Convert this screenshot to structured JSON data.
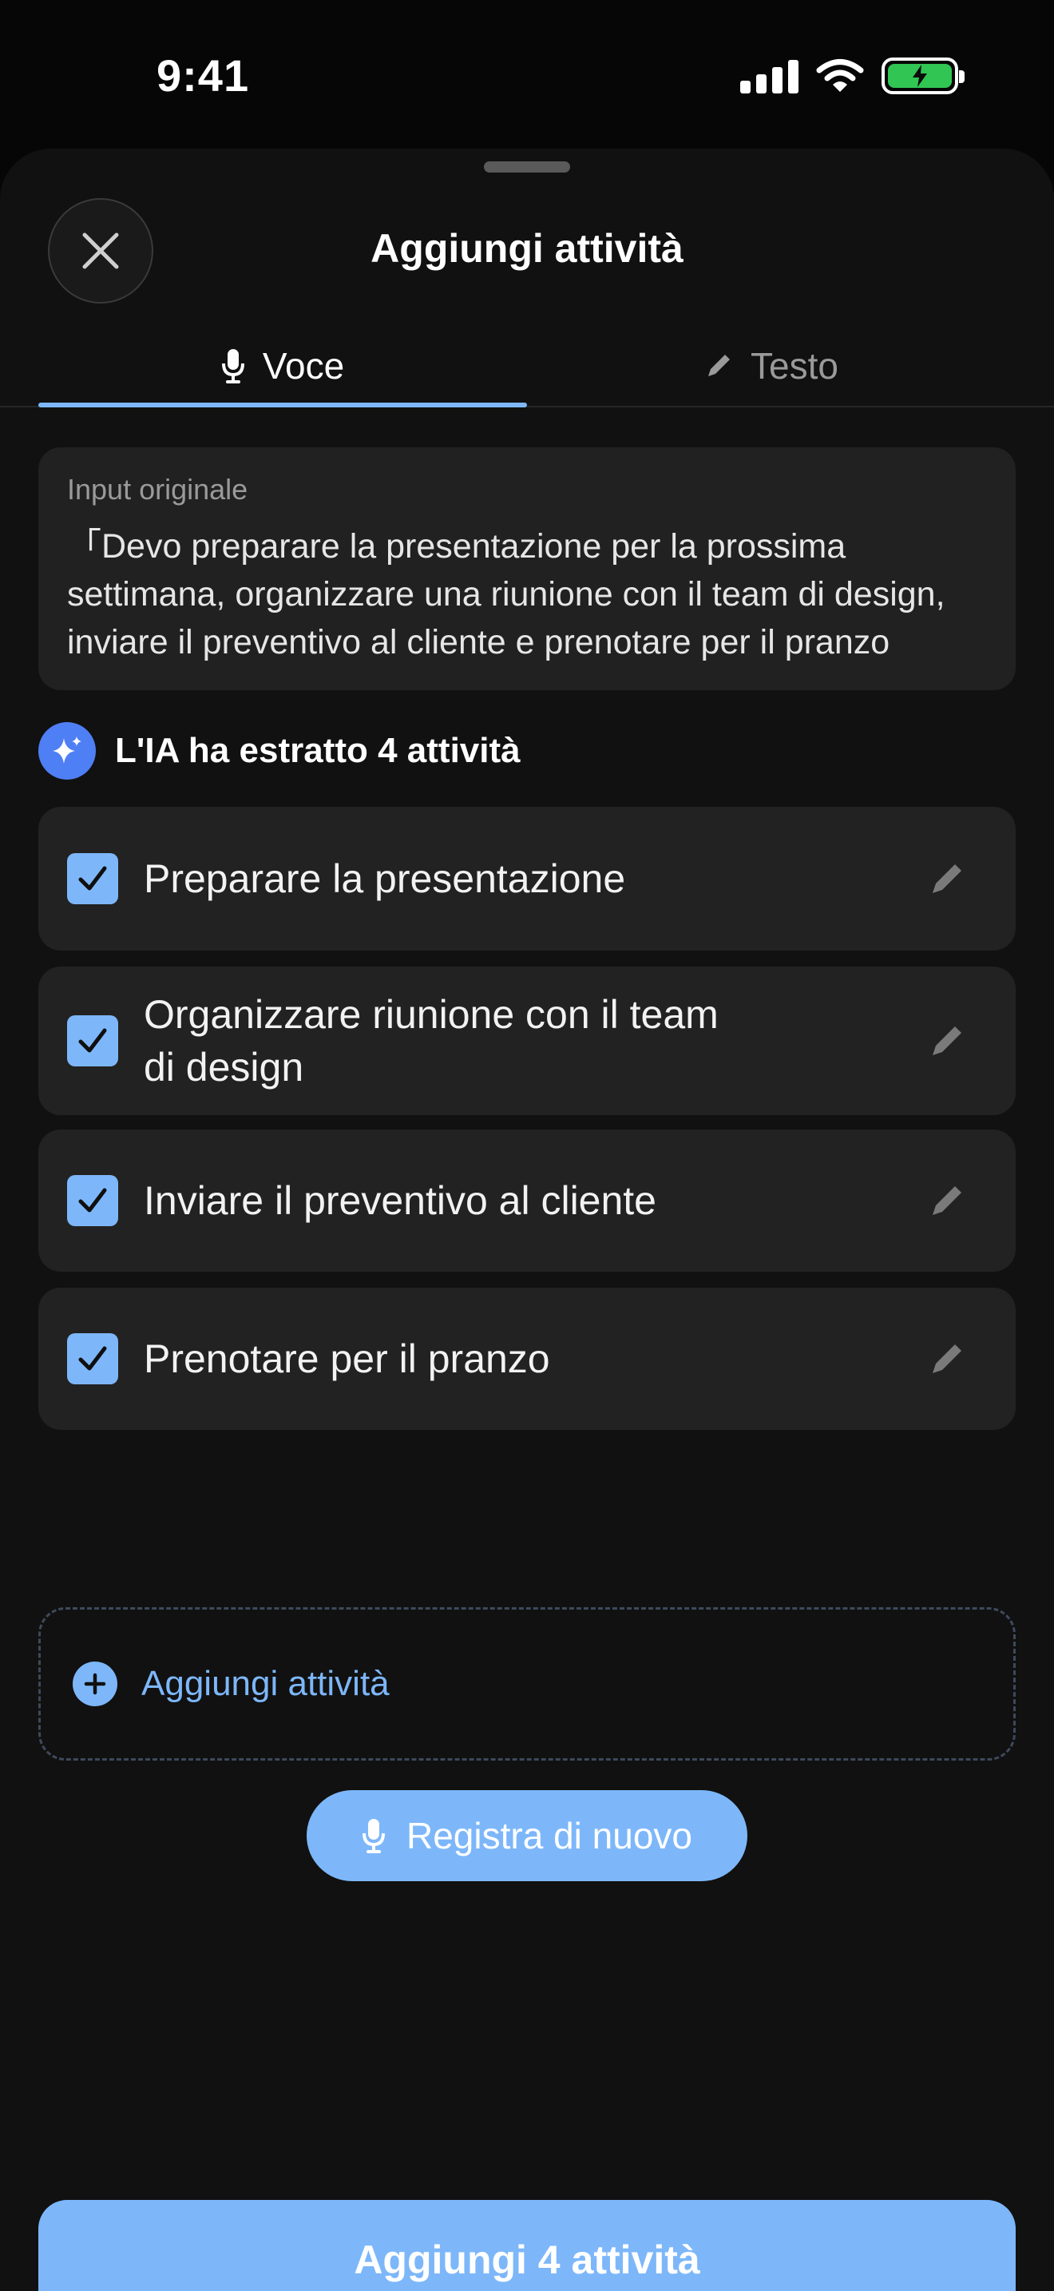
{
  "status_bar": {
    "time": "9:41"
  },
  "sheet": {
    "title": "Aggiungi attività"
  },
  "tabs": [
    {
      "label": "Voce",
      "icon": "mic-icon",
      "active": true
    },
    {
      "label": "Testo",
      "icon": "pencil-icon",
      "active": false
    }
  ],
  "original_input": {
    "label": "Input originale",
    "text": "「Devo preparare la presentazione per la prossima settimana, organizzare una riunione con il team di design, inviare il preventivo al cliente e prenotare per il pranzo"
  },
  "ai_summary": {
    "text": "L'IA ha estratto 4 attività",
    "icon": "sparkles-icon"
  },
  "tasks": [
    {
      "label": "Preparare la presentazione",
      "checked": true
    },
    {
      "label": "Organizzare riunione con il team di design",
      "checked": true
    },
    {
      "label": "Inviare il preventivo al cliente",
      "checked": true
    },
    {
      "label": "Prenotare per il pranzo",
      "checked": true
    }
  ],
  "add_task": {
    "label": "Aggiungi attività"
  },
  "rerecord": {
    "label": "Registra di nuovo"
  },
  "primary_action": {
    "label": "Aggiungi 4 attività"
  },
  "colors": {
    "accent": "#7db7fa",
    "sheet_bg": "#111111",
    "card_bg": "#222222",
    "ai_badge": "#4f7ff5",
    "battery": "#31c553"
  }
}
